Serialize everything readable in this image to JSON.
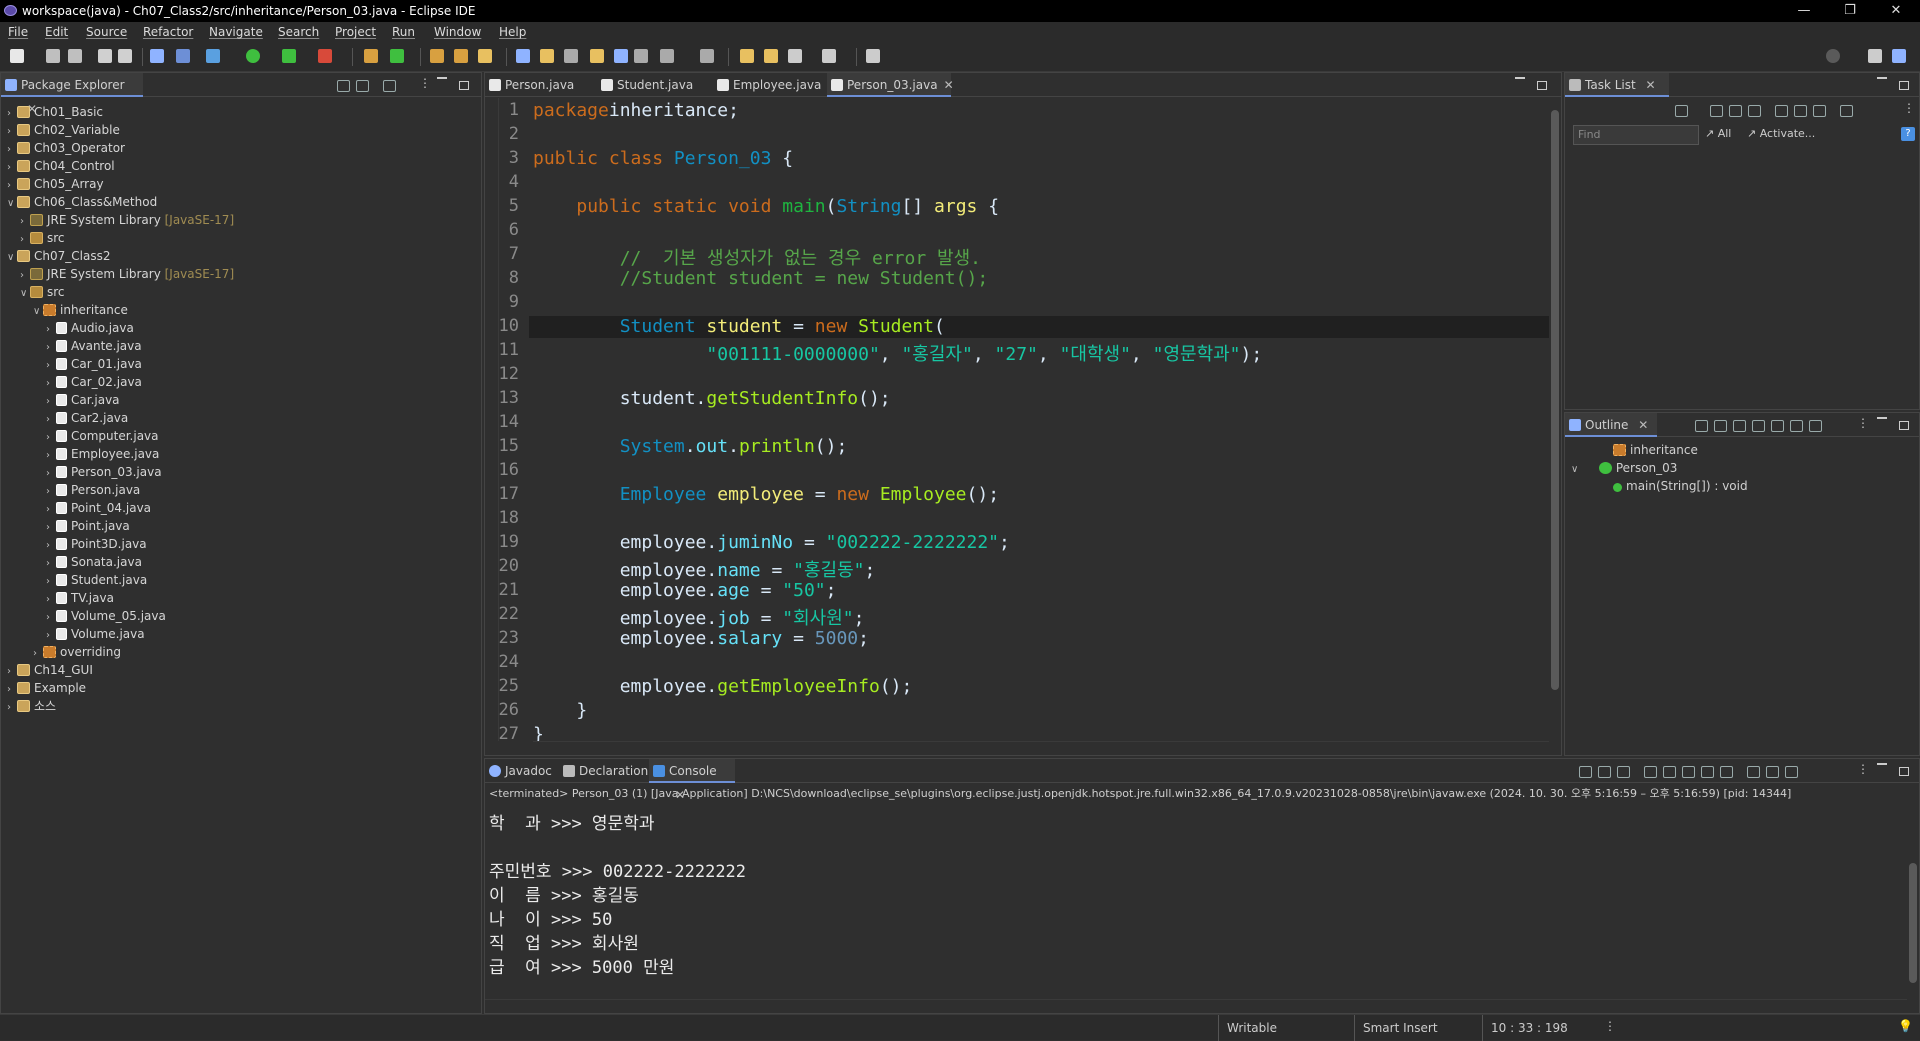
{
  "window": {
    "title": "workspace(java) - Ch07_Class2/src/inheritance/Person_03.java - Eclipse IDE"
  },
  "menu": [
    "File",
    "Edit",
    "Source",
    "Refactor",
    "Navigate",
    "Search",
    "Project",
    "Run",
    "Window",
    "Help"
  ],
  "package_explorer": {
    "title": "Package Explorer",
    "items": [
      {
        "label": "Ch01_Basic",
        "kind": "proj",
        "level": 0,
        "expanded": false
      },
      {
        "label": "Ch02_Variable",
        "kind": "proj",
        "level": 0,
        "expanded": false
      },
      {
        "label": "Ch03_Operator",
        "kind": "proj",
        "level": 0,
        "expanded": false
      },
      {
        "label": "Ch04_Control",
        "kind": "proj",
        "level": 0,
        "expanded": false
      },
      {
        "label": "Ch05_Array",
        "kind": "proj",
        "level": 0,
        "expanded": false
      },
      {
        "label": "Ch06_Class&Method",
        "kind": "proj",
        "level": 0,
        "expanded": true
      },
      {
        "label": "JRE System Library",
        "decor": "[JavaSE-17]",
        "kind": "lib",
        "level": 1,
        "expanded": false
      },
      {
        "label": "src",
        "kind": "src",
        "level": 1,
        "expanded": false
      },
      {
        "label": "Ch07_Class2",
        "kind": "proj",
        "level": 0,
        "expanded": true
      },
      {
        "label": "JRE System Library",
        "decor": "[JavaSE-17]",
        "kind": "lib",
        "level": 1,
        "expanded": false
      },
      {
        "label": "src",
        "kind": "src",
        "level": 1,
        "expanded": true
      },
      {
        "label": "inheritance",
        "kind": "pkg",
        "level": 2,
        "expanded": true
      },
      {
        "label": "Audio.java",
        "kind": "java",
        "level": 3,
        "expanded": false
      },
      {
        "label": "Avante.java",
        "kind": "java",
        "level": 3,
        "expanded": false
      },
      {
        "label": "Car_01.java",
        "kind": "java",
        "level": 3,
        "expanded": false
      },
      {
        "label": "Car_02.java",
        "kind": "java",
        "level": 3,
        "expanded": false
      },
      {
        "label": "Car.java",
        "kind": "java",
        "level": 3,
        "expanded": false
      },
      {
        "label": "Car2.java",
        "kind": "java",
        "level": 3,
        "expanded": false
      },
      {
        "label": "Computer.java",
        "kind": "java",
        "level": 3,
        "expanded": false
      },
      {
        "label": "Employee.java",
        "kind": "java",
        "level": 3,
        "expanded": false
      },
      {
        "label": "Person_03.java",
        "kind": "java",
        "level": 3,
        "expanded": false
      },
      {
        "label": "Person.java",
        "kind": "java",
        "level": 3,
        "expanded": false
      },
      {
        "label": "Point_04.java",
        "kind": "java",
        "level": 3,
        "expanded": false
      },
      {
        "label": "Point.java",
        "kind": "java",
        "level": 3,
        "expanded": false
      },
      {
        "label": "Point3D.java",
        "kind": "java",
        "level": 3,
        "expanded": false
      },
      {
        "label": "Sonata.java",
        "kind": "java",
        "level": 3,
        "expanded": false
      },
      {
        "label": "Student.java",
        "kind": "java",
        "level": 3,
        "expanded": false
      },
      {
        "label": "TV.java",
        "kind": "java",
        "level": 3,
        "expanded": false
      },
      {
        "label": "Volume_05.java",
        "kind": "java",
        "level": 3,
        "expanded": false
      },
      {
        "label": "Volume.java",
        "kind": "java",
        "level": 3,
        "expanded": false
      },
      {
        "label": "overriding",
        "kind": "pkg",
        "level": 2,
        "expanded": false
      },
      {
        "label": "Ch14_GUI",
        "kind": "proj",
        "level": 0,
        "expanded": false
      },
      {
        "label": "Example",
        "kind": "proj",
        "level": 0,
        "expanded": false
      },
      {
        "label": "소스",
        "kind": "proj",
        "level": 0,
        "expanded": false
      }
    ]
  },
  "editor": {
    "tabs": [
      {
        "label": "Person.java",
        "active": false
      },
      {
        "label": "Student.java",
        "active": false
      },
      {
        "label": "Employee.java",
        "active": false
      },
      {
        "label": "Person_03.java",
        "active": true
      }
    ],
    "current_line": 10,
    "lines": [
      [
        [
          "kw",
          "package"
        ],
        [
          "",
          "inheritance;"
        ]
      ],
      [],
      [
        [
          "kw",
          "public class "
        ],
        [
          "ty",
          "Person_03"
        ],
        [
          "",
          " {"
        ]
      ],
      [],
      [
        [
          "",
          "    "
        ],
        [
          "kw",
          "public static void "
        ],
        [
          "fn",
          "main"
        ],
        [
          "",
          "("
        ],
        [
          "ty",
          "String"
        ],
        [
          "",
          "[] "
        ],
        [
          "var",
          "args"
        ],
        [
          "",
          " {"
        ]
      ],
      [],
      [
        [
          "",
          "        "
        ],
        [
          "cm",
          "//  기본 생성자가 없는 경우 error 발생."
        ]
      ],
      [
        [
          "",
          "        "
        ],
        [
          "cm",
          "//Student student = new Student();"
        ]
      ],
      [],
      [
        [
          "",
          "        "
        ],
        [
          "ty",
          "Student"
        ],
        [
          "",
          " "
        ],
        [
          "var",
          "student"
        ],
        [
          "",
          " = "
        ],
        [
          "kw",
          "new "
        ],
        [
          "mt",
          "Student"
        ],
        [
          "",
          "("
        ]
      ],
      [
        [
          "",
          "                "
        ],
        [
          "st",
          "\"001111-0000000\""
        ],
        [
          "",
          ", "
        ],
        [
          "st",
          "\"홍길자\""
        ],
        [
          "",
          ", "
        ],
        [
          "st",
          "\"27\""
        ],
        [
          "",
          ", "
        ],
        [
          "st",
          "\"대학생\""
        ],
        [
          "",
          ", "
        ],
        [
          "st",
          "\"영문학과\""
        ],
        [
          "",
          ");"
        ]
      ],
      [],
      [
        [
          "",
          "        "
        ],
        [
          "",
          "student."
        ],
        [
          "mt",
          "getStudentInfo"
        ],
        [
          "",
          "();"
        ]
      ],
      [],
      [
        [
          "",
          "        "
        ],
        [
          "ty",
          "System"
        ],
        [
          "",
          "."
        ],
        [
          "fld",
          "out"
        ],
        [
          "",
          "."
        ],
        [
          "mt",
          "println"
        ],
        [
          "",
          "();"
        ]
      ],
      [],
      [
        [
          "",
          "        "
        ],
        [
          "ty",
          "Employee"
        ],
        [
          "",
          " "
        ],
        [
          "var",
          "employee"
        ],
        [
          "",
          " = "
        ],
        [
          "kw",
          "new "
        ],
        [
          "mt",
          "Employee"
        ],
        [
          "",
          "();"
        ]
      ],
      [],
      [
        [
          "",
          "        "
        ],
        [
          "",
          "employee."
        ],
        [
          "fld",
          "juminNo"
        ],
        [
          "",
          " = "
        ],
        [
          "st",
          "\"002222-2222222\""
        ],
        [
          "",
          ";"
        ]
      ],
      [
        [
          "",
          "        "
        ],
        [
          "",
          "employee."
        ],
        [
          "fld",
          "name"
        ],
        [
          "",
          " = "
        ],
        [
          "st",
          "\"홍길동\""
        ],
        [
          "",
          ";"
        ]
      ],
      [
        [
          "",
          "        "
        ],
        [
          "",
          "employee."
        ],
        [
          "fld",
          "age"
        ],
        [
          "",
          " = "
        ],
        [
          "st",
          "\"50\""
        ],
        [
          "",
          ";"
        ]
      ],
      [
        [
          "",
          "        "
        ],
        [
          "",
          "employee."
        ],
        [
          "fld",
          "job"
        ],
        [
          "",
          " = "
        ],
        [
          "st",
          "\"회사원\""
        ],
        [
          "",
          ";"
        ]
      ],
      [
        [
          "",
          "        "
        ],
        [
          "",
          "employee."
        ],
        [
          "fld",
          "salary"
        ],
        [
          "",
          " = "
        ],
        [
          "num",
          "5000"
        ],
        [
          "",
          ";"
        ]
      ],
      [],
      [
        [
          "",
          "        "
        ],
        [
          "",
          "employee."
        ],
        [
          "mt",
          "getEmployeeInfo"
        ],
        [
          "",
          "();"
        ]
      ],
      [
        [
          "",
          "    }"
        ]
      ],
      [
        [
          "",
          "}"
        ]
      ]
    ]
  },
  "task_list": {
    "title": "Task List",
    "find_placeholder": "Find",
    "all_label": "All",
    "activate_label": "Activate..."
  },
  "outline": {
    "title": "Outline",
    "items": [
      {
        "label": "inheritance",
        "level": 0
      },
      {
        "label": "Person_03",
        "level": 0
      },
      {
        "label": "main(String[]) : void",
        "level": 1
      }
    ]
  },
  "bottom": {
    "tabs": [
      {
        "label": "Javadoc",
        "active": false
      },
      {
        "label": "Declaration",
        "active": false
      },
      {
        "label": "Console",
        "active": true
      }
    ],
    "status_line": "<terminated> Person_03 (1) [Java Application] D:\\NCS\\download\\eclipse_se\\plugins\\org.eclipse.justj.openjdk.hotspot.jre.full.win32.x86_64_17.0.9.v20231028-0858\\jre\\bin\\javaw.exe  (2024. 10. 30. 오후 5:16:59 – 오후 5:16:59) [pid: 14344]",
    "output": [
      "학  과 >>> 영문학과",
      "",
      "주민번호 >>> 002222-2222222",
      "이  름 >>> 홍길동",
      "나  이 >>> 50",
      "직  업 >>> 회사원",
      "급  여 >>> 5000 만원"
    ]
  },
  "status": {
    "writable": "Writable",
    "insert_mode": "Smart Insert",
    "position": "10 : 33 : 198"
  },
  "colors": {
    "accent": "#6d8fd6",
    "background": "#2f2f2f"
  }
}
